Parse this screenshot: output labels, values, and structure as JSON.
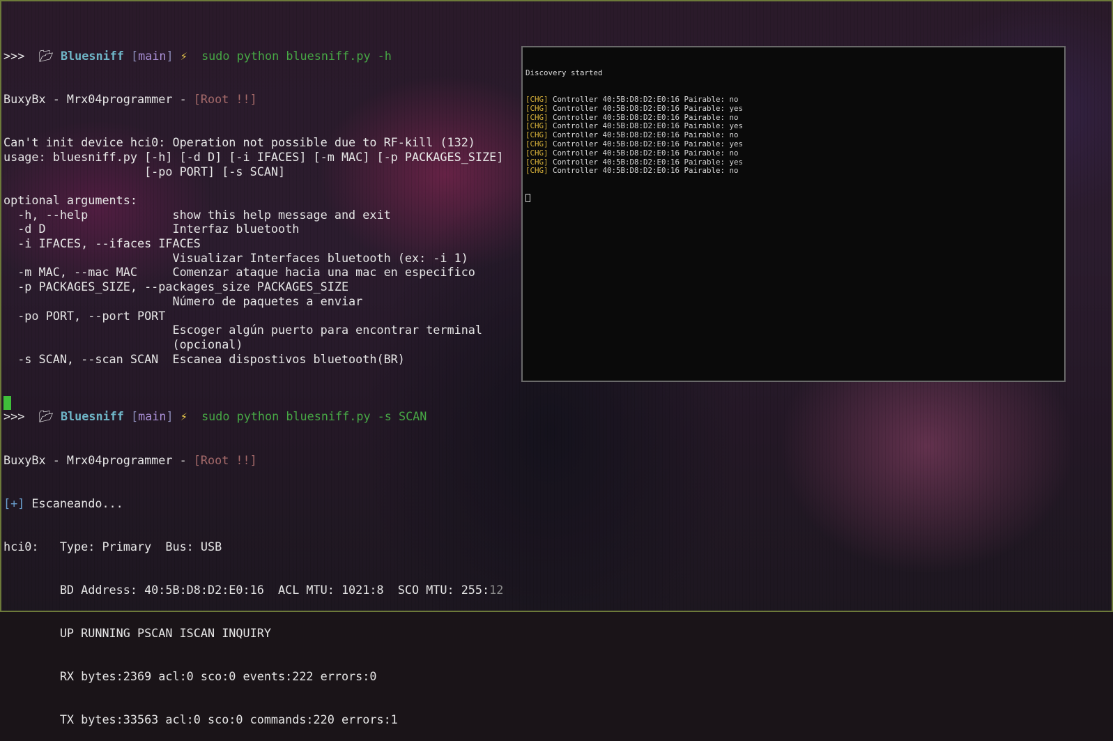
{
  "prompt": {
    "arrows": ">>>",
    "folder_icon": "folder-icon",
    "dir": "Bluesniff",
    "branch": "main",
    "bolt_icon": "lightning-icon"
  },
  "commands": {
    "help": "sudo python bluesniff.py -h",
    "scan": "sudo python bluesniff.py -s SCAN"
  },
  "banner": {
    "text": "BuxyBx - Mrx04programmer - ",
    "root": "[Root !!]"
  },
  "help_output": [
    "Can't init device hci0: Operation not possible due to RF-kill (132)",
    "usage: bluesniff.py [-h] [-d D] [-i IFACES] [-m MAC] [-p PACKAGES_SIZE]",
    "                    [-po PORT] [-s SCAN]",
    "",
    "optional arguments:",
    "  -h, --help            show this help message and exit",
    "  -d D                  Interfaz bluetooth",
    "  -i IFACES, --ifaces IFACES",
    "                        Visualizar Interfaces bluetooth (ex: -i 1)",
    "  -m MAC, --mac MAC     Comenzar ataque hacia una mac en especifico",
    "  -p PACKAGES_SIZE, --packages_size PACKAGES_SIZE",
    "                        Número de paquetes a enviar",
    "  -po PORT, --port PORT",
    "                        Escoger algún puerto para encontrar terminal",
    "                        (opcional)",
    "  -s SCAN, --scan SCAN  Escanea dispostivos bluetooth(BR)"
  ],
  "scan_output": {
    "status_prefix": "[+]",
    "status_text": " Escaneando...",
    "lines_main": [
      "hci0:   Type: Primary  Bus: USB",
      "        BD Address: 40:5B:D8:D2:E0:16  ACL MTU: 1021:8  SCO MTU: 255:"
    ],
    "bd_tail": "12",
    "lines_rest": [
      "        UP RUNNING PSCAN ISCAN INQUIRY",
      "        RX bytes:2369 acl:0 sco:0 events:222 errors:0",
      "        TX bytes:33563 acl:0 sco:0 commands:220 errors:1"
    ]
  },
  "popup": {
    "header": "Discovery started",
    "tag": "[CHG]",
    "entries": [
      " Controller 40:5B:D8:D2:E0:16 Pairable: no",
      " Controller 40:5B:D8:D2:E0:16 Pairable: yes",
      " Controller 40:5B:D8:D2:E0:16 Pairable: no",
      " Controller 40:5B:D8:D2:E0:16 Pairable: yes",
      " Controller 40:5B:D8:D2:E0:16 Pairable: no",
      " Controller 40:5B:D8:D2:E0:16 Pairable: yes",
      " Controller 40:5B:D8:D2:E0:16 Pairable: no",
      " Controller 40:5B:D8:D2:E0:16 Pairable: yes",
      " Controller 40:5B:D8:D2:E0:16 Pairable: no"
    ]
  },
  "colors": {
    "command": "#47a845",
    "directory": "#6fb6c8",
    "chg_tag": "#d9b23a",
    "cursor": "#3fbf3a",
    "frame": "#6d7a3a"
  }
}
